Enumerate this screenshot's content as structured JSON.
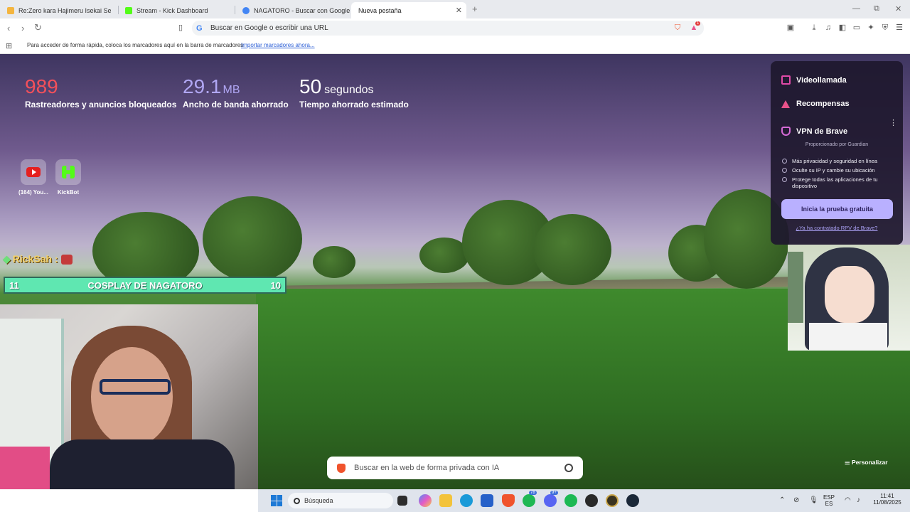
{
  "browser": {
    "tabs": [
      {
        "title": "Re:Zero kara Hajimeru Isekai Seikatsu",
        "icon_color": "#f4b53f"
      },
      {
        "title": "Stream - Kick Dashboard",
        "icon_color": "#53fc18"
      },
      {
        "title": "NAGATORO - Buscar con Google",
        "icon_color": "#4285f4"
      },
      {
        "title": "Nueva pestaña",
        "icon_color": "#ffffff"
      }
    ],
    "new_tab_symbol": "+",
    "window_controls": {
      "minimize": "—",
      "restore": "⧉",
      "close": "✕"
    },
    "omnibox_placeholder": "Buscar en Google o escribir una URL",
    "bookmarks_hint": "Para acceder de forma rápida, coloca los marcadores aquí en la barra de marcadores",
    "bookmarks_import_link": "Importar marcadores ahora...",
    "rewards_badge": "1"
  },
  "stats": [
    {
      "number": "989",
      "unit": "",
      "label": "Rastreadores y anuncios bloqueados",
      "color": "#f4505a"
    },
    {
      "number": "29.1",
      "unit": "MB",
      "label": "Ancho de banda ahorrado",
      "color": "#b1a7f4"
    },
    {
      "number": "50",
      "unit": "segundos",
      "label": "Tiempo ahorrado estimado",
      "color": "#ffffff"
    }
  ],
  "shortcuts": [
    {
      "label": "(164) You...",
      "icon": "youtube-icon"
    },
    {
      "label": "KickBot",
      "icon": "kickbot-icon"
    }
  ],
  "stream_overlay": {
    "chat_user": "RickSah :",
    "goal_left": "11",
    "goal_title": "COSPLAY DE NAGATORO",
    "goal_right": "10"
  },
  "side_panel": {
    "videocall": "Videollamada",
    "rewards": "Recompensas",
    "vpn_title": "VPN de Brave",
    "powered_by": "Proporcionado por Guardian",
    "features": [
      "Más privacidad y seguridad en línea",
      "Oculte su IP y cambie su ubicación",
      "Protege todas las aplicaciones de tu dispositivo"
    ],
    "cta": "Inicia la prueba gratuita",
    "already_link": "¿Ya ha contratado RPV de Brave?"
  },
  "search": {
    "placeholder": "Buscar en la web de forma privada con IA"
  },
  "customize_label": "Personalizar",
  "taskbar": {
    "search_label": "Búsqueda",
    "whatsapp_badge": "78",
    "discord_badge": "9+",
    "lang_top": "ESP",
    "lang_bottom": "ES",
    "time": "11:41",
    "date": "11/08/2025"
  }
}
